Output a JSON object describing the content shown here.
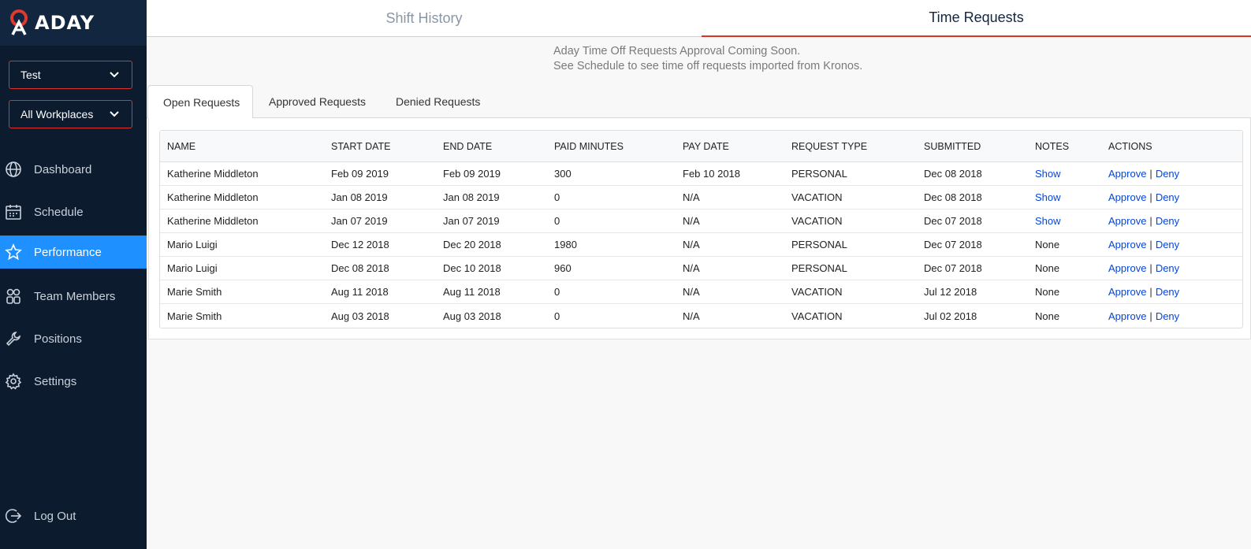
{
  "brand": {
    "name": "ADAY"
  },
  "selectors": {
    "org": "Test",
    "workplace": "All Workplaces"
  },
  "nav": [
    {
      "label": "Dashboard",
      "icon": "globe-icon"
    },
    {
      "label": "Schedule",
      "icon": "calendar-icon"
    },
    {
      "label": "Performance",
      "icon": "star-icon",
      "active": true
    },
    {
      "label": "Team Members",
      "icon": "team-icon"
    },
    {
      "label": "Positions",
      "icon": "wrench-icon"
    },
    {
      "label": "Settings",
      "icon": "gear-icon"
    }
  ],
  "logout": {
    "label": "Log Out",
    "icon": "logout-icon"
  },
  "header_tabs": [
    {
      "label": "Shift History"
    },
    {
      "label": "Time Requests",
      "active": true
    }
  ],
  "notice": {
    "line1": "Aday Time Off Requests Approval Coming Soon.",
    "line2": "See Schedule to see time off requests imported from Kronos."
  },
  "sub_tabs": [
    {
      "label": "Open Requests",
      "active": true
    },
    {
      "label": "Approved Requests"
    },
    {
      "label": "Denied Requests"
    }
  ],
  "table": {
    "columns": [
      "NAME",
      "START DATE",
      "END DATE",
      "PAID MINUTES",
      "PAY DATE",
      "REQUEST TYPE",
      "SUBMITTED",
      "NOTES",
      "ACTIONS"
    ],
    "rows": [
      {
        "name": "Katherine Middleton",
        "start": "Feb 09 2019",
        "end": "Feb 09 2019",
        "paid": "300",
        "pay_date": "Feb 10 2018",
        "type": "PERSONAL",
        "submitted": "Dec 08 2018",
        "notes": "Show",
        "notes_link": true
      },
      {
        "name": "Katherine Middleton",
        "start": "Jan 08 2019",
        "end": "Jan 08 2019",
        "paid": "0",
        "pay_date": "N/A",
        "type": "VACATION",
        "submitted": "Dec 08 2018",
        "notes": "Show",
        "notes_link": true
      },
      {
        "name": "Katherine Middleton",
        "start": "Jan 07 2019",
        "end": "Jan 07 2019",
        "paid": "0",
        "pay_date": "N/A",
        "type": "VACATION",
        "submitted": "Dec 07 2018",
        "notes": "Show",
        "notes_link": true
      },
      {
        "name": "Mario Luigi",
        "start": "Dec 12 2018",
        "end": "Dec 20 2018",
        "paid": "1980",
        "pay_date": "N/A",
        "type": "PERSONAL",
        "submitted": "Dec 07 2018",
        "notes": "None",
        "notes_link": false
      },
      {
        "name": "Mario Luigi",
        "start": "Dec 08 2018",
        "end": "Dec 10 2018",
        "paid": "960",
        "pay_date": "N/A",
        "type": "PERSONAL",
        "submitted": "Dec 07 2018",
        "notes": "None",
        "notes_link": false
      },
      {
        "name": "Marie Smith",
        "start": "Aug 11 2018",
        "end": "Aug 11 2018",
        "paid": "0",
        "pay_date": "N/A",
        "type": "VACATION",
        "submitted": "Jul 12 2018",
        "notes": "None",
        "notes_link": false
      },
      {
        "name": "Marie Smith",
        "start": "Aug 03 2018",
        "end": "Aug 03 2018",
        "paid": "0",
        "pay_date": "N/A",
        "type": "VACATION",
        "submitted": "Jul 02 2018",
        "notes": "None",
        "notes_link": false
      }
    ],
    "actions": {
      "approve": "Approve",
      "separator": "|",
      "deny": "Deny"
    }
  },
  "colors": {
    "sidebar_bg": "#0c1b2e",
    "accent_red": "#d9342b",
    "active_blue": "#1e90ff",
    "link_blue": "#0645d6"
  }
}
